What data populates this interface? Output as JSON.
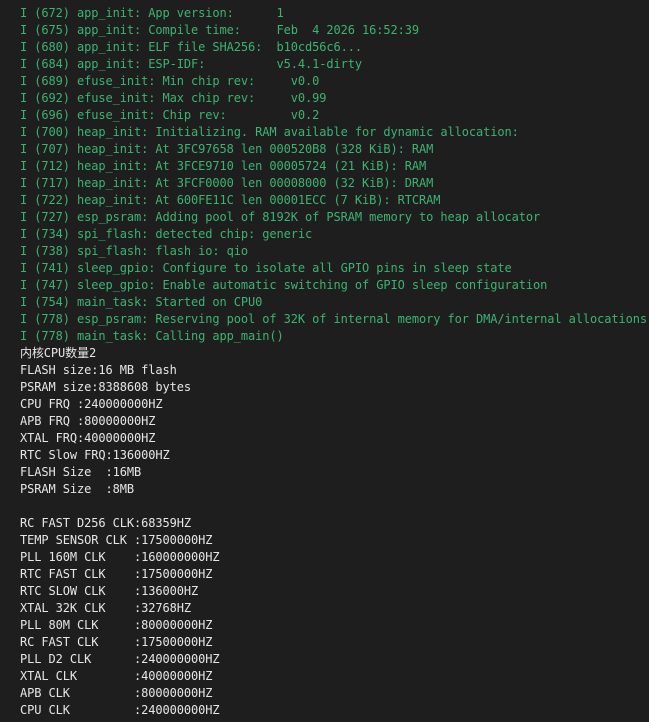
{
  "colors": {
    "background": "#1e1e1e",
    "log_info": "#3cb371",
    "stdout": "#e6e6e6"
  },
  "log_lines": [
    "I (672) app_init: App version:      1",
    "I (675) app_init: Compile time:     Feb  4 2026 16:52:39",
    "I (680) app_init: ELF file SHA256:  b10cd56c6...",
    "I (684) app_init: ESP-IDF:          v5.4.1-dirty",
    "I (689) efuse_init: Min chip rev:     v0.0",
    "I (692) efuse_init: Max chip rev:     v0.99",
    "I (696) efuse_init: Chip rev:         v0.2",
    "I (700) heap_init: Initializing. RAM available for dynamic allocation:",
    "I (707) heap_init: At 3FC97658 len 000520B8 (328 KiB): RAM",
    "I (712) heap_init: At 3FCE9710 len 00005724 (21 KiB): RAM",
    "I (717) heap_init: At 3FCF0000 len 00008000 (32 KiB): DRAM",
    "I (722) heap_init: At 600FE11C len 00001ECC (7 KiB): RTCRAM",
    "I (727) esp_psram: Adding pool of 8192K of PSRAM memory to heap allocator",
    "I (734) spi_flash: detected chip: generic",
    "I (738) spi_flash: flash io: qio",
    "I (741) sleep_gpio: Configure to isolate all GPIO pins in sleep state",
    "I (747) sleep_gpio: Enable automatic switching of GPIO sleep configuration",
    "I (754) main_task: Started on CPU0",
    "I (778) esp_psram: Reserving pool of 32K of internal memory for DMA/internal allocations",
    "I (778) main_task: Calling app_main()"
  ],
  "output_lines": [
    "内核CPU数量2",
    "FLASH size:16 MB flash",
    "PSRAM size:8388608 bytes",
    "CPU FRQ :240000000HZ",
    "APB FRQ :80000000HZ",
    "XTAL FRQ:40000000HZ",
    "RTC Slow FRQ:136000HZ",
    "FLASH Size  :16MB",
    "PSRAM Size  :8MB",
    "",
    "RC FAST D256 CLK:68359HZ",
    "TEMP SENSOR CLK :17500000HZ",
    "PLL 160M CLK    :160000000HZ",
    "RTC FAST CLK    :17500000HZ",
    "RTC SLOW CLK    :136000HZ",
    "XTAL 32K CLK    :32768HZ",
    "PLL 80M CLK     :80000000HZ",
    "RC FAST CLK     :17500000HZ",
    "PLL D2 CLK      :240000000HZ",
    "XTAL CLK        :40000000HZ",
    "APB CLK         :80000000HZ",
    "CPU CLK         :240000000HZ"
  ]
}
